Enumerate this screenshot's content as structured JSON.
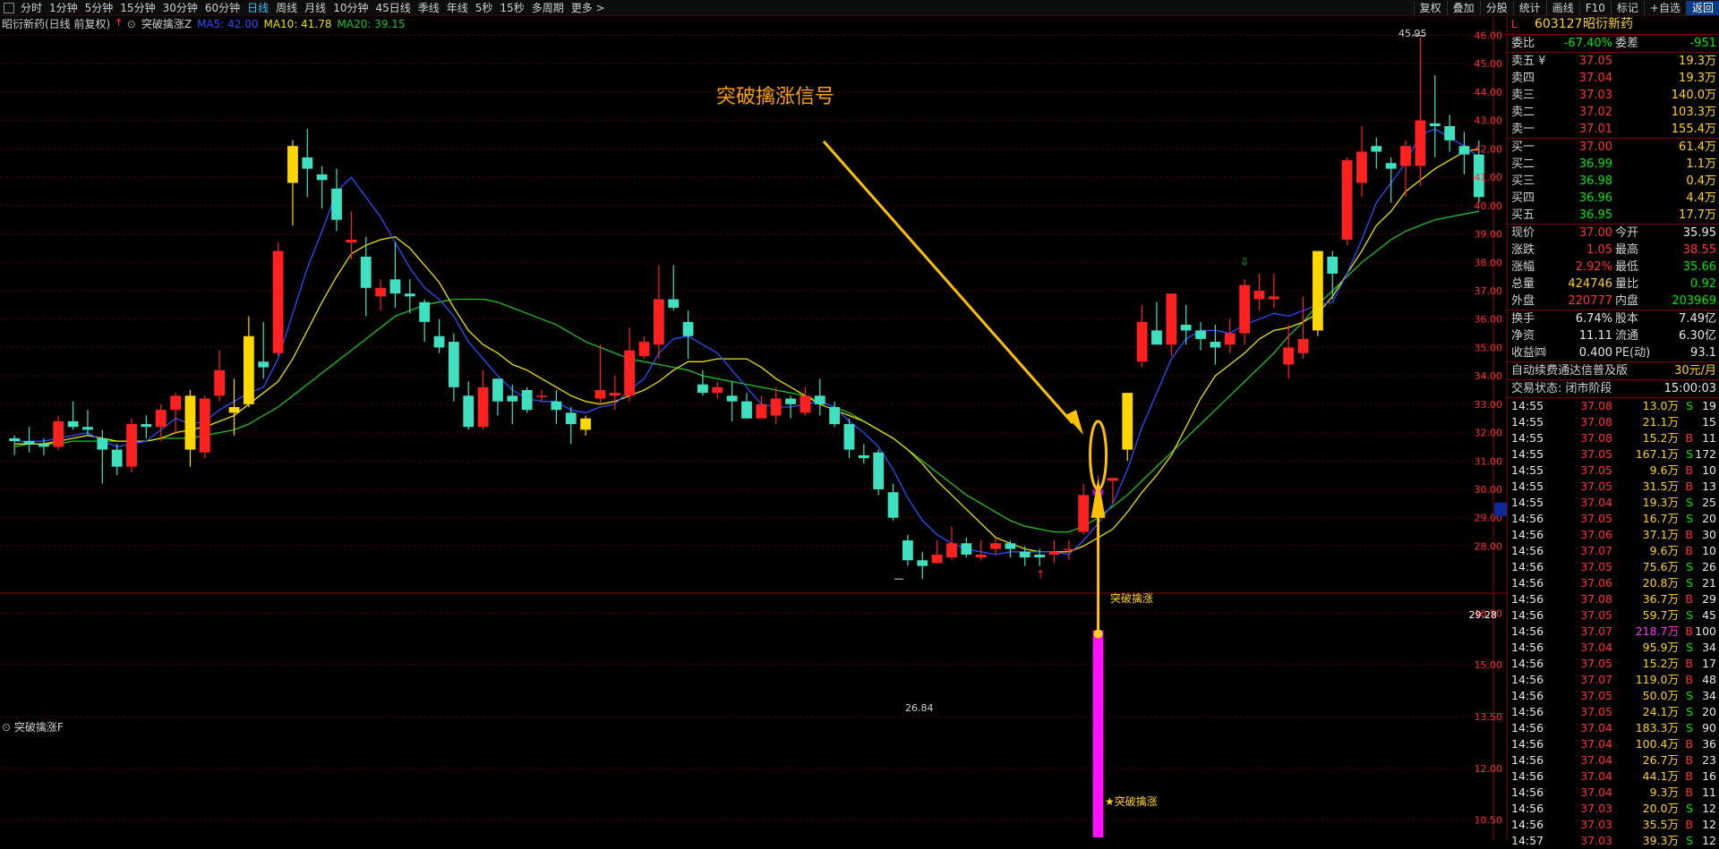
{
  "toolbar": {
    "periods": [
      "分时",
      "1分钟",
      "5分钟",
      "15分钟",
      "30分钟",
      "60分钟",
      "日线",
      "周线",
      "月线",
      "10分钟",
      "45日线",
      "季线",
      "年线",
      "5秒",
      "15秒",
      "多周期",
      "更多 >"
    ],
    "active_period": "日线",
    "right_buttons": [
      "复权",
      "叠加",
      "分股",
      "统计",
      "画线",
      "F10",
      "标记",
      "+自选",
      "返回"
    ]
  },
  "chart_header": {
    "stock_label": "昭衍新药(日线 前复权)",
    "indicator_name": "突破擒涨Z",
    "ma5": "MA5: 42.00",
    "ma10": "MA10: 41.78",
    "ma20": "MA20: 39.15"
  },
  "annotation_title": "突破擒涨信号",
  "signal_label": "突破擒涨",
  "signal_label_sub": "★突破擒涨",
  "high_label": "45.95",
  "low_label": "26.84",
  "current_price_tag": "29.28",
  "sub_panel_title": "突破擒涨F",
  "price_axis": [
    "46.00",
    "45.00",
    "44.00",
    "43.00",
    "42.00",
    "41.00",
    "40.00",
    "39.00",
    "38.00",
    "37.00",
    "36.00",
    "35.00",
    "34.00",
    "33.00",
    "32.00",
    "31.00",
    "30.00",
    "29.00",
    "28.00"
  ],
  "sub_axis": [
    "16.50",
    "15.00",
    "13.50",
    "12.00",
    "10.50"
  ],
  "colors": {
    "up": "#ff2020",
    "down": "#3fe0c0",
    "signal": "#ffd700",
    "ma5": "#2a4dff",
    "ma10": "#e8e000",
    "ma20": "#20c020",
    "magenta": "#ff10ff"
  },
  "quote": {
    "header": {
      "prefix": "L",
      "code": "603127",
      "name": "昭衍新药"
    },
    "weibi": {
      "label": "委比",
      "value": "-67.40%",
      "label2": "委差",
      "value2": "-951"
    },
    "sells": [
      {
        "label": "卖五 ¥",
        "price": "37.05",
        "vol": "19.3万"
      },
      {
        "label": "卖四",
        "price": "37.04",
        "vol": "19.3万"
      },
      {
        "label": "卖三",
        "price": "37.03",
        "vol": "140.0万"
      },
      {
        "label": "卖二",
        "price": "37.02",
        "vol": "103.3万"
      },
      {
        "label": "卖一",
        "price": "37.01",
        "vol": "155.4万"
      }
    ],
    "buys": [
      {
        "label": "买一",
        "price": "37.00",
        "vol": "61.4万"
      },
      {
        "label": "买二",
        "price": "36.99",
        "vol": "1.1万"
      },
      {
        "label": "买三",
        "price": "36.98",
        "vol": "0.4万"
      },
      {
        "label": "买四",
        "price": "36.96",
        "vol": "4.4万"
      },
      {
        "label": "买五",
        "price": "36.95",
        "vol": "17.7万"
      }
    ],
    "stats": [
      {
        "l1": "现价",
        "v1": "37.00",
        "c1": "red",
        "l2": "今开",
        "v2": "35.95",
        "c2": "white"
      },
      {
        "l1": "涨跌",
        "v1": "1.05",
        "c1": "red",
        "l2": "最高",
        "v2": "38.55",
        "c2": "red"
      },
      {
        "l1": "涨幅",
        "v1": "2.92%",
        "c1": "red",
        "l2": "最低",
        "v2": "35.66",
        "c2": "green"
      },
      {
        "l1": "总量",
        "v1": "424746",
        "c1": "yellow",
        "l2": "量比",
        "v2": "0.92",
        "c2": "green"
      },
      {
        "l1": "外盘",
        "v1": "220777",
        "c1": "red",
        "l2": "内盘",
        "v2": "203969",
        "c2": "green"
      }
    ],
    "fundamentals": [
      {
        "l1": "换手",
        "v1": "6.74%",
        "l2": "股本",
        "v2": "7.49亿"
      },
      {
        "l1": "净资",
        "v1": "11.11",
        "l2": "流通",
        "v2": "6.30亿"
      },
      {
        "l1": "收益㈣",
        "v1": "0.400",
        "l2": "PE(动)",
        "v2": "93.1"
      }
    ],
    "promo": {
      "text": "自动续费通达信普及版",
      "price": "30元/月"
    },
    "status": {
      "label": "交易状态: 闭市阶段",
      "time": "15:00:03"
    },
    "ticks": [
      {
        "t": "14:55",
        "p": "37.08",
        "v": "13.0万",
        "s": "S",
        "n": "19"
      },
      {
        "t": "14:55",
        "p": "37.08",
        "v": "21.1万",
        "s": "",
        "n": "15"
      },
      {
        "t": "14:55",
        "p": "37.08",
        "v": "15.2万",
        "s": "B",
        "n": "11"
      },
      {
        "t": "14:55",
        "p": "37.05",
        "v": "167.1万",
        "s": "S",
        "n": "172"
      },
      {
        "t": "14:55",
        "p": "37.05",
        "v": "9.6万",
        "s": "B",
        "n": "10"
      },
      {
        "t": "14:55",
        "p": "37.05",
        "v": "31.5万",
        "s": "B",
        "n": "13"
      },
      {
        "t": "14:55",
        "p": "37.04",
        "v": "19.3万",
        "s": "S",
        "n": "25"
      },
      {
        "t": "14:56",
        "p": "37.05",
        "v": "16.7万",
        "s": "S",
        "n": "20"
      },
      {
        "t": "14:56",
        "p": "37.06",
        "v": "37.1万",
        "s": "B",
        "n": "30"
      },
      {
        "t": "14:56",
        "p": "37.07",
        "v": "9.6万",
        "s": "B",
        "n": "10"
      },
      {
        "t": "14:56",
        "p": "37.05",
        "v": "75.6万",
        "s": "S",
        "n": "26"
      },
      {
        "t": "14:56",
        "p": "37.06",
        "v": "20.8万",
        "s": "S",
        "n": "21"
      },
      {
        "t": "14:56",
        "p": "37.08",
        "v": "36.7万",
        "s": "B",
        "n": "29"
      },
      {
        "t": "14:56",
        "p": "37.05",
        "v": "59.7万",
        "s": "S",
        "n": "45"
      },
      {
        "t": "14:56",
        "p": "37.07",
        "v": "218.7万",
        "s": "B",
        "n": "100"
      },
      {
        "t": "14:56",
        "p": "37.04",
        "v": "95.9万",
        "s": "S",
        "n": "34"
      },
      {
        "t": "14:56",
        "p": "37.05",
        "v": "15.2万",
        "s": "B",
        "n": "17"
      },
      {
        "t": "14:56",
        "p": "37.07",
        "v": "119.0万",
        "s": "B",
        "n": "48"
      },
      {
        "t": "14:56",
        "p": "37.05",
        "v": "50.0万",
        "s": "S",
        "n": "34"
      },
      {
        "t": "14:56",
        "p": "37.05",
        "v": "24.1万",
        "s": "S",
        "n": "20"
      },
      {
        "t": "14:56",
        "p": "37.04",
        "v": "183.3万",
        "s": "S",
        "n": "90"
      },
      {
        "t": "14:56",
        "p": "37.04",
        "v": "100.4万",
        "s": "B",
        "n": "36"
      },
      {
        "t": "14:56",
        "p": "37.04",
        "v": "26.7万",
        "s": "B",
        "n": "23"
      },
      {
        "t": "14:56",
        "p": "37.04",
        "v": "44.1万",
        "s": "B",
        "n": "16"
      },
      {
        "t": "14:56",
        "p": "37.04",
        "v": "9.3万",
        "s": "B",
        "n": "11"
      },
      {
        "t": "14:56",
        "p": "37.03",
        "v": "20.0万",
        "s": "S",
        "n": "12"
      },
      {
        "t": "14:56",
        "p": "37.03",
        "v": "35.5万",
        "s": "B",
        "n": "12"
      },
      {
        "t": "14:57",
        "p": "37.03",
        "v": "39.3万",
        "s": "S",
        "n": "12"
      }
    ]
  },
  "chart_data": {
    "type": "candlestick",
    "ylim": [
      26.5,
      46.3
    ],
    "sub_ylim": [
      10,
      17
    ],
    "candles": [
      [
        31.8,
        31.9,
        31.2,
        31.7
      ],
      [
        31.7,
        32.2,
        31.3,
        31.6
      ],
      [
        31.6,
        31.8,
        31.2,
        31.5
      ],
      [
        31.5,
        32.6,
        31.4,
        32.4
      ],
      [
        32.4,
        33.1,
        32.1,
        32.2
      ],
      [
        32.2,
        32.8,
        31.9,
        32.1
      ],
      [
        31.8,
        32.1,
        30.2,
        31.4
      ],
      [
        31.4,
        31.6,
        30.5,
        30.8
      ],
      [
        30.8,
        32.5,
        30.6,
        32.3
      ],
      [
        32.3,
        32.6,
        31.8,
        32.2
      ],
      [
        32.2,
        33.0,
        31.7,
        32.8
      ],
      [
        32.8,
        33.4,
        32.0,
        33.3
      ],
      [
        33.3,
        33.5,
        30.8,
        31.4
      ],
      [
        31.3,
        33.3,
        31.1,
        33.2
      ],
      [
        33.3,
        34.9,
        33.1,
        34.2
      ],
      [
        32.7,
        33.9,
        31.9,
        32.9
      ],
      [
        33.0,
        36.1,
        32.9,
        35.4
      ],
      [
        34.5,
        35.9,
        33.9,
        34.3
      ],
      [
        34.8,
        38.7,
        34.7,
        38.4
      ],
      [
        40.8,
        42.3,
        39.3,
        42.1
      ],
      [
        41.7,
        42.7,
        40.3,
        41.3
      ],
      [
        41.1,
        41.4,
        39.9,
        40.9
      ],
      [
        40.6,
        41.3,
        39.1,
        39.5
      ],
      [
        38.7,
        39.8,
        38.1,
        38.8
      ],
      [
        38.2,
        38.9,
        36.1,
        37.1
      ],
      [
        36.8,
        37.4,
        36.3,
        37.1
      ],
      [
        37.4,
        38.7,
        36.4,
        36.9
      ],
      [
        36.9,
        37.4,
        36.2,
        36.8
      ],
      [
        36.6,
        36.7,
        35.2,
        35.9
      ],
      [
        35.4,
        36.0,
        34.8,
        35.0
      ],
      [
        35.2,
        35.5,
        33.1,
        33.6
      ],
      [
        33.3,
        33.8,
        32.1,
        32.2
      ],
      [
        32.2,
        34.2,
        32.1,
        33.6
      ],
      [
        33.9,
        33.9,
        32.6,
        33.1
      ],
      [
        33.3,
        33.7,
        32.3,
        33.1
      ],
      [
        33.5,
        33.6,
        32.7,
        32.8
      ],
      [
        33.3,
        33.5,
        33.1,
        33.3
      ],
      [
        33.1,
        33.5,
        32.3,
        32.8
      ],
      [
        32.7,
        32.9,
        31.6,
        32.3
      ],
      [
        32.1,
        32.6,
        31.9,
        32.5
      ],
      [
        33.2,
        35.1,
        33.0,
        33.5
      ],
      [
        33.3,
        34.0,
        32.8,
        33.4
      ],
      [
        33.3,
        35.7,
        33.1,
        34.9
      ],
      [
        34.7,
        35.4,
        34.6,
        35.2
      ],
      [
        35.1,
        37.9,
        34.6,
        36.7
      ],
      [
        36.7,
        37.9,
        36.3,
        36.4
      ],
      [
        35.9,
        36.3,
        34.6,
        35.4
      ],
      [
        33.7,
        34.2,
        33.3,
        33.4
      ],
      [
        33.4,
        33.8,
        33.2,
        33.6
      ],
      [
        33.3,
        33.8,
        32.4,
        33.1
      ],
      [
        33.1,
        33.4,
        32.5,
        32.5
      ],
      [
        32.5,
        33.3,
        32.5,
        33.0
      ],
      [
        32.6,
        33.6,
        32.3,
        33.2
      ],
      [
        33.2,
        33.3,
        32.5,
        33.0
      ],
      [
        32.7,
        33.6,
        32.6,
        33.3
      ],
      [
        33.3,
        33.9,
        32.6,
        33.0
      ],
      [
        32.9,
        33.1,
        32.2,
        32.3
      ],
      [
        32.3,
        32.5,
        31.1,
        31.4
      ],
      [
        31.2,
        31.6,
        30.9,
        31.1
      ],
      [
        31.3,
        31.4,
        29.8,
        30.0
      ],
      [
        29.9,
        30.2,
        28.9,
        29.0
      ],
      [
        28.2,
        28.4,
        27.3,
        27.5
      ],
      [
        27.5,
        27.8,
        26.84,
        27.3
      ],
      [
        27.4,
        28.2,
        27.4,
        27.7
      ],
      [
        27.6,
        28.7,
        27.5,
        28.1
      ],
      [
        28.1,
        28.3,
        27.6,
        27.7
      ],
      [
        27.6,
        28.2,
        27.5,
        27.7
      ],
      [
        27.9,
        28.3,
        27.7,
        28.1
      ],
      [
        28.1,
        28.2,
        27.6,
        27.9
      ],
      [
        27.8,
        28.0,
        27.3,
        27.6
      ],
      [
        27.7,
        27.9,
        27.3,
        27.6
      ],
      [
        27.7,
        28.2,
        27.4,
        27.8
      ],
      [
        27.9,
        28.2,
        27.5,
        27.9
      ],
      [
        28.5,
        30.2,
        28.4,
        29.8
      ],
      [
        29.8,
        30.5,
        28.8,
        30.0
      ],
      [
        30.3,
        30.4,
        29.5,
        30.4
      ],
      [
        31.4,
        33.3,
        31.0,
        33.4
      ],
      [
        34.5,
        36.5,
        34.3,
        35.9
      ],
      [
        35.6,
        36.6,
        35.2,
        35.1
      ],
      [
        35.1,
        36.9,
        34.7,
        36.9
      ],
      [
        35.8,
        36.5,
        35.1,
        35.6
      ],
      [
        35.6,
        35.9,
        34.9,
        35.3
      ],
      [
        35.2,
        35.8,
        34.4,
        35.0
      ],
      [
        35.1,
        36.0,
        34.8,
        35.5
      ],
      [
        35.5,
        37.4,
        35.1,
        37.2
      ],
      [
        36.7,
        37.6,
        36.3,
        37.0
      ],
      [
        36.7,
        37.6,
        36.4,
        36.8
      ],
      [
        34.4,
        35.8,
        33.9,
        35.0
      ],
      [
        34.8,
        36.8,
        34.6,
        35.3
      ],
      [
        35.6,
        38.3,
        35.4,
        38.4
      ],
      [
        38.2,
        38.4,
        36.7,
        37.6
      ],
      [
        38.8,
        41.7,
        38.6,
        41.6
      ],
      [
        40.8,
        42.8,
        40.3,
        41.9
      ],
      [
        42.1,
        42.4,
        41.3,
        41.9
      ],
      [
        41.5,
        41.7,
        40.1,
        41.3
      ],
      [
        41.4,
        42.3,
        40.3,
        42.1
      ],
      [
        41.4,
        45.95,
        40.7,
        43.0
      ],
      [
        42.9,
        44.6,
        41.7,
        42.8
      ],
      [
        42.8,
        43.2,
        41.9,
        42.3
      ],
      [
        42.1,
        42.6,
        41.1,
        41.8
      ],
      [
        41.8,
        42.3,
        40.1,
        40.3
      ]
    ],
    "signal_indices": [
      12,
      15,
      16,
      19,
      39,
      76,
      89
    ],
    "breakout_index": 74,
    "ma5": [
      31.7,
      31.7,
      31.7,
      31.8,
      31.9,
      32.0,
      31.7,
      31.5,
      31.6,
      31.7,
      32.1,
      32.5,
      32.3,
      32.4,
      32.8,
      33.1,
      33.4,
      33.6,
      34.6,
      36.2,
      37.8,
      39.1,
      40.5,
      41.0,
      40.3,
      39.6,
      38.7,
      37.8,
      37.1,
      36.7,
      36.1,
      35.2,
      34.6,
      34.0,
      33.5,
      33.2,
      33.1,
      33.1,
      32.8,
      32.7,
      32.9,
      33.0,
      33.5,
      33.9,
      34.8,
      35.3,
      35.4,
      35.1,
      34.8,
      34.2,
      33.6,
      33.0,
      32.9,
      32.9,
      33.0,
      33.1,
      32.9,
      32.4,
      32.0,
      31.5,
      30.7,
      29.7,
      28.9,
      28.4,
      28.1,
      27.9,
      27.8,
      27.7,
      27.8,
      27.8,
      27.8,
      27.8,
      27.7,
      28.2,
      28.8,
      29.5,
      30.7,
      32.2,
      33.4,
      34.6,
      35.3,
      35.6,
      35.6,
      35.5,
      35.8,
      36.0,
      36.2,
      36.1,
      36.3,
      36.5,
      36.6,
      37.6,
      38.8,
      40.1,
      40.8,
      41.5,
      42.5,
      42.7,
      42.4,
      42.1,
      41.7
    ],
    "ma10": [
      31.6,
      31.6,
      31.6,
      31.7,
      31.8,
      31.9,
      31.8,
      31.7,
      31.7,
      31.7,
      31.8,
      32.0,
      32.1,
      32.2,
      32.4,
      32.6,
      33.0,
      33.4,
      33.8,
      34.6,
      35.6,
      36.6,
      37.5,
      38.3,
      38.6,
      38.8,
      38.9,
      38.5,
      37.9,
      37.3,
      36.4,
      35.6,
      35.1,
      34.8,
      34.4,
      34.2,
      33.9,
      33.6,
      33.3,
      33.1,
      33.0,
      33.1,
      33.3,
      33.5,
      33.8,
      34.2,
      34.5,
      34.5,
      34.6,
      34.6,
      34.6,
      34.3,
      33.9,
      33.6,
      33.3,
      33.0,
      32.8,
      32.6,
      32.4,
      32.1,
      31.8,
      31.4,
      30.9,
      30.3,
      29.8,
      29.3,
      28.8,
      28.3,
      28.1,
      27.9,
      27.8,
      27.8,
      27.8,
      28.0,
      28.3,
      28.6,
      29.2,
      29.9,
      30.5,
      31.2,
      32.2,
      33.2,
      34.0,
      34.4,
      34.8,
      35.3,
      35.6,
      35.7,
      35.9,
      36.2,
      36.8,
      37.6,
      38.4,
      39.3,
      39.8,
      40.5,
      40.9,
      41.3,
      41.6,
      41.9,
      42.0
    ],
    "ma20": [
      31.5,
      31.6,
      31.6,
      31.6,
      31.7,
      31.7,
      31.7,
      31.7,
      31.7,
      31.7,
      31.8,
      31.8,
      31.8,
      31.9,
      32.0,
      32.1,
      32.3,
      32.6,
      32.9,
      33.3,
      33.7,
      34.1,
      34.5,
      34.9,
      35.3,
      35.7,
      36.1,
      36.3,
      36.5,
      36.6,
      36.7,
      36.7,
      36.7,
      36.6,
      36.4,
      36.2,
      36.0,
      35.8,
      35.5,
      35.2,
      35.0,
      34.8,
      34.6,
      34.5,
      34.4,
      34.3,
      34.2,
      34.0,
      33.9,
      33.8,
      33.7,
      33.6,
      33.5,
      33.4,
      33.3,
      33.1,
      32.9,
      32.7,
      32.4,
      32.1,
      31.8,
      31.4,
      31.0,
      30.6,
      30.2,
      29.8,
      29.5,
      29.2,
      28.9,
      28.7,
      28.6,
      28.5,
      28.5,
      28.7,
      29.0,
      29.4,
      29.8,
      30.3,
      30.8,
      31.3,
      31.8,
      32.3,
      32.8,
      33.3,
      33.8,
      34.3,
      34.8,
      35.4,
      35.9,
      36.5,
      37.0,
      37.5,
      38.0,
      38.4,
      38.8,
      39.1,
      39.3,
      39.5,
      39.6,
      39.7,
      39.8
    ],
    "sub_bar": {
      "index": 74,
      "value": 16.0
    }
  }
}
